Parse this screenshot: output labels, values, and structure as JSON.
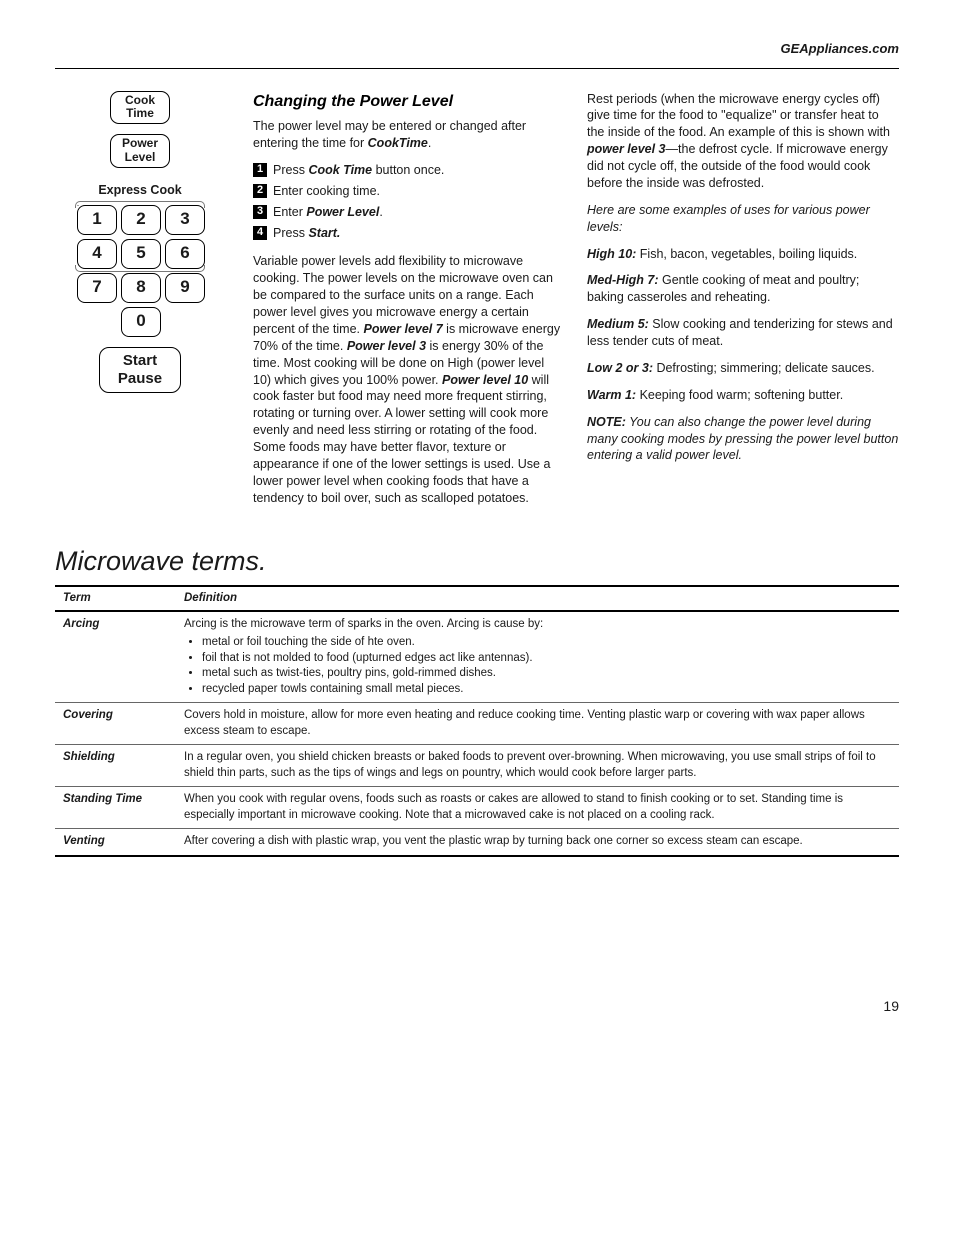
{
  "header_url": "GEAppliances.com",
  "panel": {
    "cook_time": "Cook\nTime",
    "power_level": "Power\nLevel",
    "express": "Express Cook",
    "keys": [
      "1",
      "2",
      "3",
      "4",
      "5",
      "6",
      "7",
      "8",
      "9",
      "0"
    ],
    "start_pause": "Start\nPause"
  },
  "section": {
    "title": "Changing the Power Level",
    "intro_a": "The power level may be entered or changed after entering the time for ",
    "intro_b": "CookTime",
    "intro_c": ".",
    "steps": [
      {
        "pre": "Press ",
        "bold": "Cook Time",
        "post": " button once."
      },
      {
        "pre": "Enter cooking time.",
        "bold": "",
        "post": ""
      },
      {
        "pre": "Enter ",
        "bold": "Power Level",
        "post": "."
      },
      {
        "pre": "Press ",
        "bold": "Start.",
        "post": ""
      }
    ],
    "para1_a": "Variable power levels add flexibility to microwave cooking. The power levels on the microwave oven can be compared to the surface units on a range. Each power level gives you microwave energy a certain percent of the time. ",
    "para1_b": "Power level 7",
    "para1_c": " is microwave energy 70% of the time. ",
    "para1_d": "Power level 3",
    "para1_e": " is energy 30% of the time. Most cooking will be done on High (power level 10) which gives you 100% power. ",
    "para1_f": "Power level 10",
    "para1_g": " will cook faster but food may need more frequent stirring, rotating or turning over. A lower setting will cook more evenly and need less stirring or rotating of the food. Some foods may have better flavor, texture or appearance if one of the lower settings is used. Use a lower power level when cooking foods that have a tendency to boil over, such as scalloped potatoes.",
    "para2_a": "Rest periods (when the microwave energy cycles off) give time for the food to \"equalize\" or transfer heat to the inside  of the food. An example of this is shown with ",
    "para2_b": "power level 3",
    "para2_c": "—the defrost cycle. If microwave energy did not cycle off, the outside of the food would cook before the inside was defrosted.",
    "examples_lead": "Here are some examples of uses for various power levels:",
    "levels": [
      {
        "name": "High 10:",
        "desc": "  Fish, bacon, vegetables, boiling liquids."
      },
      {
        "name": "Med-High 7:",
        "desc": "  Gentle cooking of meat and poultry; baking casseroles and reheating."
      },
      {
        "name": "Medium 5:",
        "desc": "  Slow cooking and tenderizing for stews and less tender cuts of meat."
      },
      {
        "name": "Low 2 or 3:",
        "desc": "  Defrosting; simmering; delicate sauces."
      },
      {
        "name": "Warm 1:",
        "desc": "  Keeping food warm; softening butter."
      }
    ],
    "note_label": "NOTE:",
    "note_body": "  You can also change the power level during many cooking modes by pressing the power level button entering a valid power level."
  },
  "terms": {
    "heading": "Microwave terms.",
    "col_term": "Term",
    "col_def": "Definition",
    "rows": [
      {
        "term": "Arcing",
        "def_lead": "Arcing is the microwave term of sparks in the oven.  Arcing is cause by:",
        "bullets": [
          "metal or foil touching the side of hte oven.",
          "foil that is not molded to food (upturned edges act like antennas).",
          "metal such as twist-ties, poultry pins, gold-rimmed dishes.",
          "recycled paper towls containing small metal pieces."
        ]
      },
      {
        "term": "Covering",
        "def": "Covers hold in moisture, allow for more even heating and reduce cooking time.  Venting plastic warp or covering with wax paper allows excess steam to escape."
      },
      {
        "term": "Shielding",
        "def": "In a regular oven, you shield chicken breasts or baked foods to prevent over-browning.  When microwaving, you use small strips of foil to shield thin parts, such as the tips of wings and legs on pountry, which would cook before larger parts."
      },
      {
        "term": "Standing Time",
        "def": "When you cook with regular ovens, foods such as roasts or cakes are allowed to stand to finish cooking or to set.  Standing time is especially important in microwave cooking.  Note that a microwaved cake is not placed on a cooling rack."
      },
      {
        "term": "Venting",
        "def": "After covering a dish with plastic wrap, you vent the plastic wrap by turning back one corner so excess steam can escape."
      }
    ]
  },
  "page_number": "19"
}
